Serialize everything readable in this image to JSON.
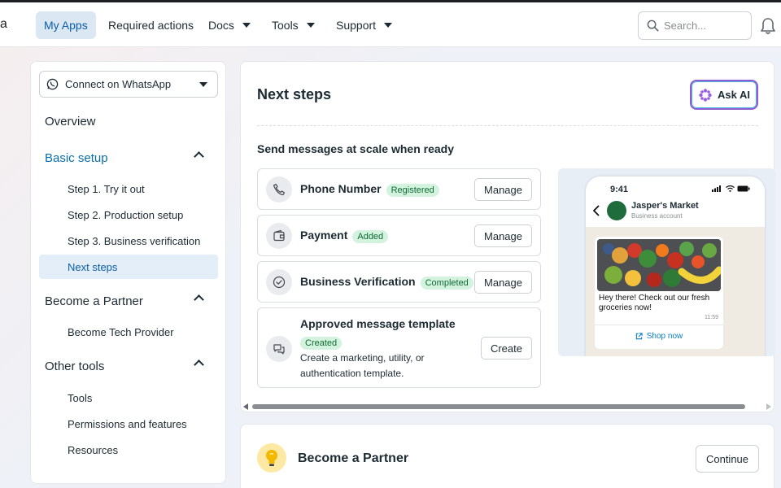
{
  "topnav": {
    "logo_fragment": "a",
    "items": [
      {
        "label": "My Apps",
        "active": true
      },
      {
        "label": "Required actions"
      },
      {
        "label": "Docs",
        "dropdown": true
      },
      {
        "label": "Tools",
        "dropdown": true
      },
      {
        "label": "Support",
        "dropdown": true
      }
    ],
    "search_placeholder": "Search...",
    "accent_color": "#0a5eaa"
  },
  "sidebar": {
    "selector_label": "Connect on WhatsApp",
    "overview": "Overview",
    "sections": [
      {
        "title": "Basic setup",
        "expanded": true,
        "items": [
          "Step 1. Try it out",
          "Step 2. Production setup",
          "Step 3. Business verification",
          "Next steps"
        ],
        "active_item": "Next steps"
      },
      {
        "title": "Become a Partner",
        "expanded": true,
        "items": [
          "Become Tech Provider"
        ]
      },
      {
        "title": "Other tools",
        "expanded": true,
        "items": [
          "Tools",
          "Permissions and features",
          "Resources"
        ]
      }
    ]
  },
  "main": {
    "title": "Next steps",
    "ask_ai_label": "Ask AI",
    "section_label": "Send messages at scale when ready",
    "cards": [
      {
        "title": "Phone Number",
        "badge": "Registered",
        "button": "Manage",
        "icon": "phone-icon"
      },
      {
        "title": "Payment",
        "badge": "Added",
        "button": "Manage",
        "icon": "wallet-icon"
      },
      {
        "title": "Business Verification",
        "badge": "Completed",
        "button": "Manage",
        "icon": "check-circle-icon"
      },
      {
        "title": "Approved message template",
        "badge": "Created",
        "description": "Create a marketing, utility, or authentication template.",
        "button": "Create",
        "icon": "chat-bubbles-icon"
      }
    ],
    "preview": {
      "time": "9:41",
      "store_name": "Jasper's Market",
      "store_sub": "Business account",
      "message": "Hey there! Check out our fresh groceries now!",
      "message_time": "11:59",
      "link_label": "Shop now"
    }
  },
  "partner": {
    "title": "Become a Partner",
    "button": "Continue"
  }
}
